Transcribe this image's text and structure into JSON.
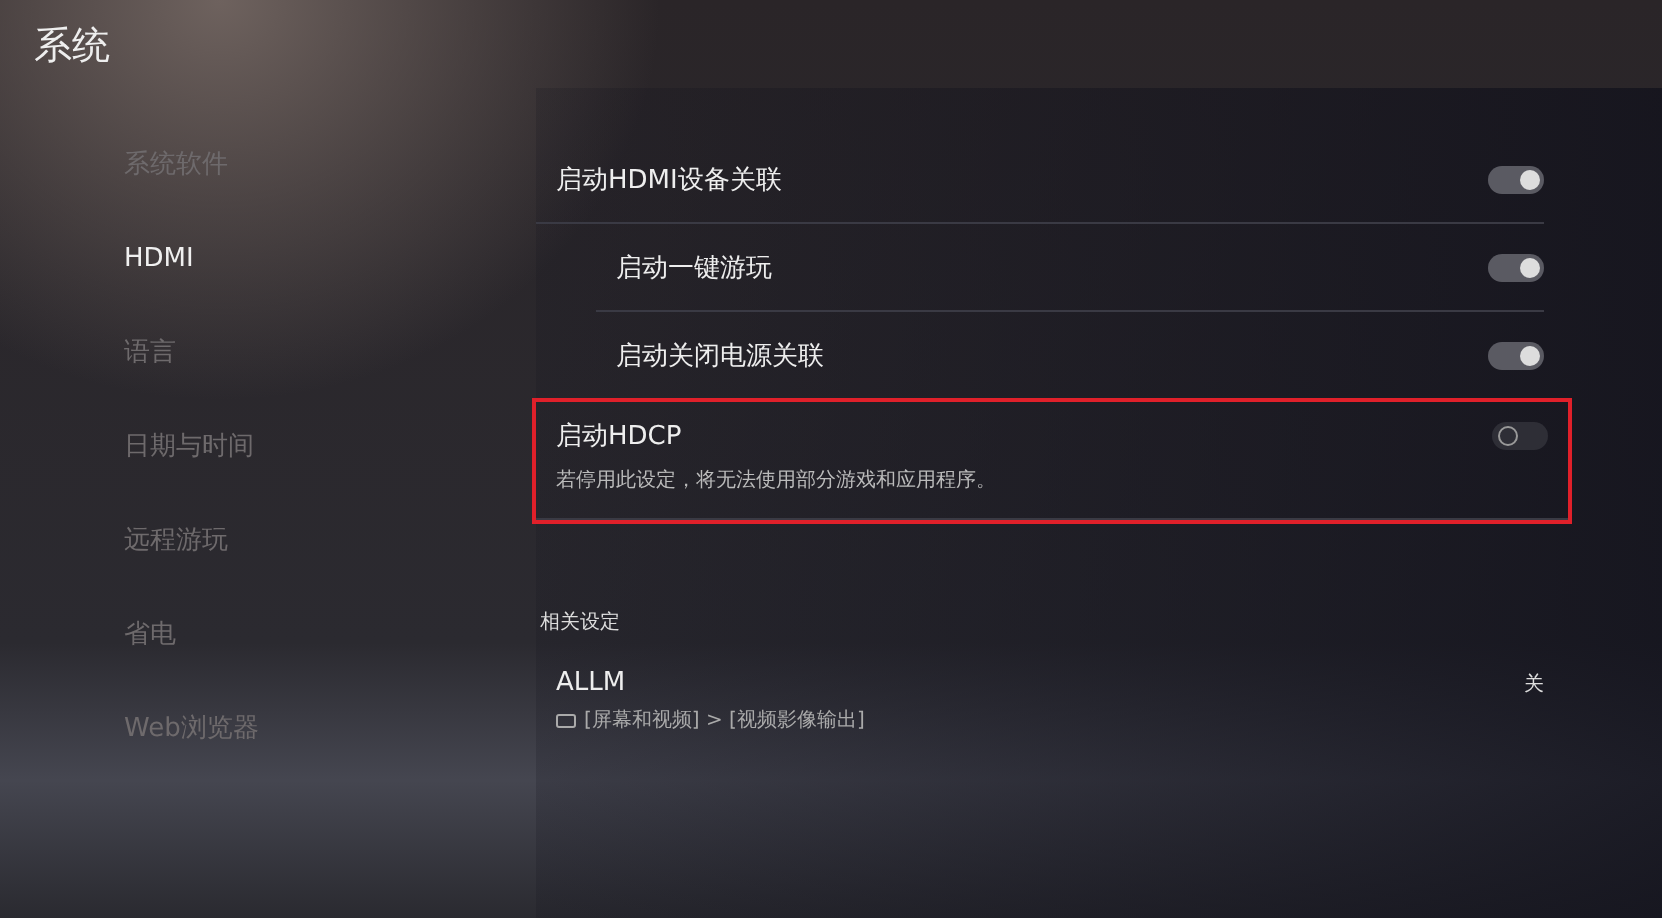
{
  "title": "系统",
  "sidebar": {
    "items": [
      {
        "label": "系统软件",
        "selected": false
      },
      {
        "label": "HDMI",
        "selected": true
      },
      {
        "label": "语言",
        "selected": false
      },
      {
        "label": "日期与时间",
        "selected": false
      },
      {
        "label": "远程游玩",
        "selected": false
      },
      {
        "label": "省电",
        "selected": false
      },
      {
        "label": "Web浏览器",
        "selected": false
      }
    ]
  },
  "settings": [
    {
      "label": "启动HDMI设备关联",
      "on": true,
      "highlighted": false,
      "children": [
        {
          "label": "启动一键游玩",
          "on": true,
          "highlighted": false
        },
        {
          "label": "启动关闭电源关联",
          "on": true,
          "highlighted": false
        }
      ]
    },
    {
      "label": "启动HDCP",
      "on": false,
      "highlighted": true,
      "description": "若停用此设定，将无法使用部分游戏和应用程序。"
    }
  ],
  "related": {
    "heading": "相关设定",
    "items": [
      {
        "label": "ALLM",
        "value": "关",
        "path": "[屏幕和视频] > [视频影像输出]"
      }
    ]
  }
}
